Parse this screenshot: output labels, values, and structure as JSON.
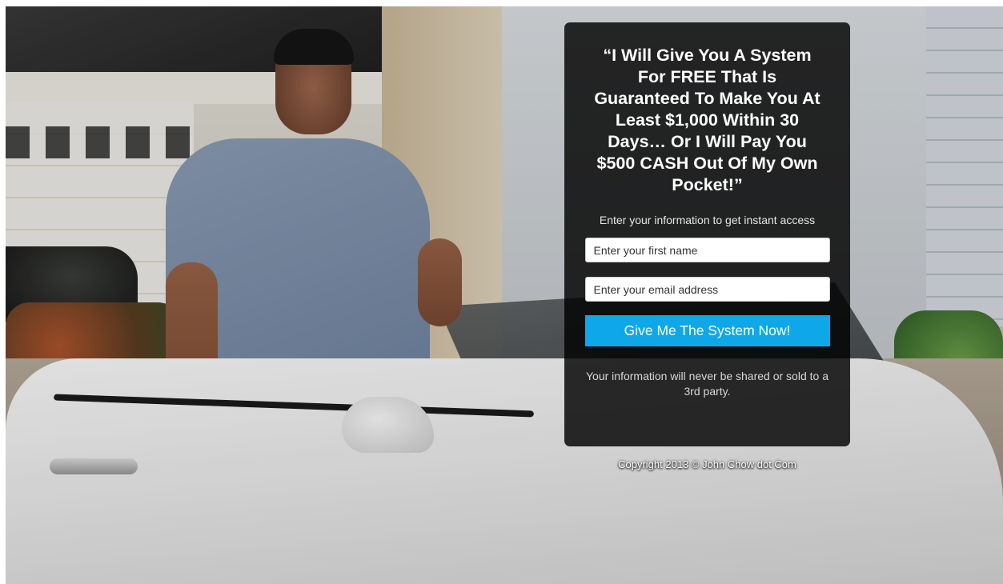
{
  "panel": {
    "headline": "“I Will Give You A System For FREE That Is Guaranteed To Make You At Least $1,000 Within 30 Days… Or I Will Pay You $500 CASH Out Of My Own Pocket!”",
    "subtext": "Enter your information to get instant access",
    "first_name_placeholder": "Enter your first name",
    "email_placeholder": "Enter your email address",
    "cta_label": "Give Me The System Now!",
    "privacy": "Your information will never be shared or sold to a 3rd party."
  },
  "footer": {
    "copyright": "Copyright 2013 © John Chow dot Com"
  },
  "colors": {
    "cta": "#0ea7e8",
    "panel_bg": "rgba(0,0,0,0.82)"
  }
}
